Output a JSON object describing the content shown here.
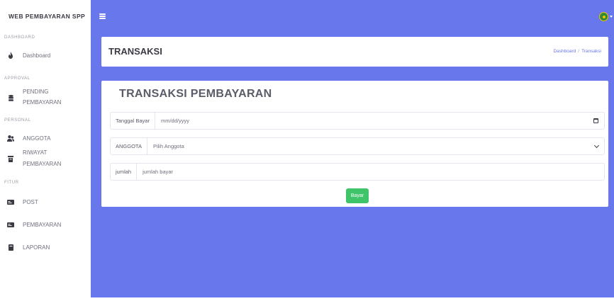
{
  "sidebar": {
    "brand": "WEB PEMBAYARAN SPP",
    "sections": {
      "dashboard": "DASHBOARD",
      "approval": "APPROVAL",
      "personal": "PERSONAL",
      "fitur": "FITUR"
    },
    "items": [
      {
        "label": "Dashboard",
        "icon": "fire-icon"
      },
      {
        "label_line1": "PENDING",
        "label_line2": "PEMBAYARAN",
        "icon": "database-icon"
      },
      {
        "label": "ANGGOTA",
        "icon": "users-icon"
      },
      {
        "label_line1": "RIWAYAT",
        "label_line2": "PEMBAYARAN",
        "icon": "archive-icon"
      },
      {
        "label": "POST",
        "icon": "card-icon"
      },
      {
        "label": "PEMBAYARAN",
        "icon": "card-icon"
      },
      {
        "label": "LAPORAN",
        "icon": "book-icon"
      }
    ]
  },
  "header": {
    "title": "TRANSAKSI",
    "breadcrumb": [
      "Dashboard",
      "Transaksi"
    ],
    "breadcrumb_sep": "/"
  },
  "form": {
    "title": "TRANSAKSI PEMBAYARAN",
    "date_label": "Tanggal Bayar",
    "date_placeholder": "mm/dd/yyyy",
    "member_label": "ANGGOTA",
    "member_selected": "Pilih Anggota",
    "amount_label": "jumlah",
    "amount_placeholder": "jumlah bayar",
    "submit_label": "Bayar"
  },
  "colors": {
    "accent": "#6878ec",
    "success": "#3fc46a"
  }
}
